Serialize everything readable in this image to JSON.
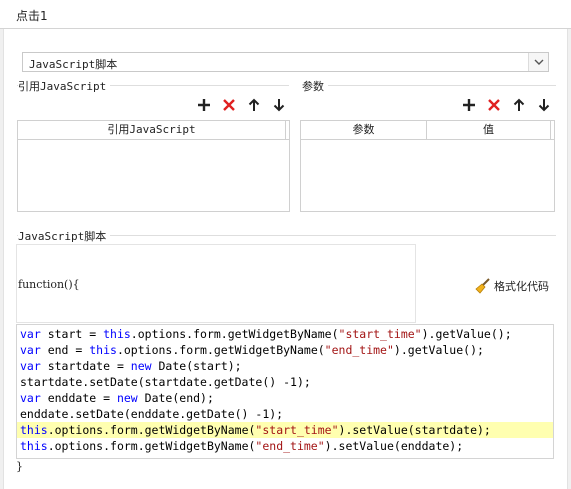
{
  "window": {
    "title": "点击1"
  },
  "script_type": {
    "selected": "JavaScript脚本"
  },
  "sections": {
    "ref_js_label": "引用JavaScript",
    "params_label": "参数",
    "script_label": "JavaScript脚本"
  },
  "ref_table": {
    "columns": [
      "引用JavaScript"
    ],
    "rows": []
  },
  "params_table": {
    "columns": [
      "参数",
      "值"
    ],
    "rows": []
  },
  "toolbar_icons": [
    "add-icon",
    "delete-icon",
    "move-up-icon",
    "move-down-icon"
  ],
  "colors": {
    "delete": "#e02020",
    "keyword": "#0000ff",
    "string": "#a31515",
    "highlight": "#ffffb0"
  },
  "code": {
    "header": "function(){",
    "format_label": "格式化代码",
    "lines": [
      [
        [
          "kw",
          "var"
        ],
        [
          "t",
          " start = "
        ],
        [
          "kw",
          "this"
        ],
        [
          "t",
          ".options.form.getWidgetByName("
        ],
        [
          "str",
          "\"start_time\""
        ],
        [
          "t",
          ").getValue();"
        ]
      ],
      [
        [
          "kw",
          "var"
        ],
        [
          "t",
          " end = "
        ],
        [
          "kw",
          "this"
        ],
        [
          "t",
          ".options.form.getWidgetByName("
        ],
        [
          "str",
          "\"end_time\""
        ],
        [
          "t",
          ").getValue();"
        ]
      ],
      [
        [
          "kw",
          "var"
        ],
        [
          "t",
          " startdate = "
        ],
        [
          "kw",
          "new"
        ],
        [
          "t",
          " Date(start);"
        ]
      ],
      [
        [
          "t",
          "startdate.setDate(startdate.getDate() -1);"
        ]
      ],
      [
        [
          "kw",
          "var"
        ],
        [
          "t",
          " enddate = "
        ],
        [
          "kw",
          "new"
        ],
        [
          "t",
          " Date(end);"
        ]
      ],
      [
        [
          "t",
          "enddate.setDate(enddate.getDate() -1);"
        ]
      ],
      [
        [
          "kw",
          "this"
        ],
        [
          "t",
          ".options.form.getWidgetByName("
        ],
        [
          "str",
          "\"start_time\""
        ],
        [
          "t",
          ").setValue(startdate);"
        ]
      ],
      [
        [
          "kw",
          "this"
        ],
        [
          "t",
          ".options.form.getWidgetByName("
        ],
        [
          "str",
          "\"end_time\""
        ],
        [
          "t",
          ").setValue(enddate);"
        ]
      ]
    ],
    "highlighted_line": 6,
    "footer": "}"
  }
}
